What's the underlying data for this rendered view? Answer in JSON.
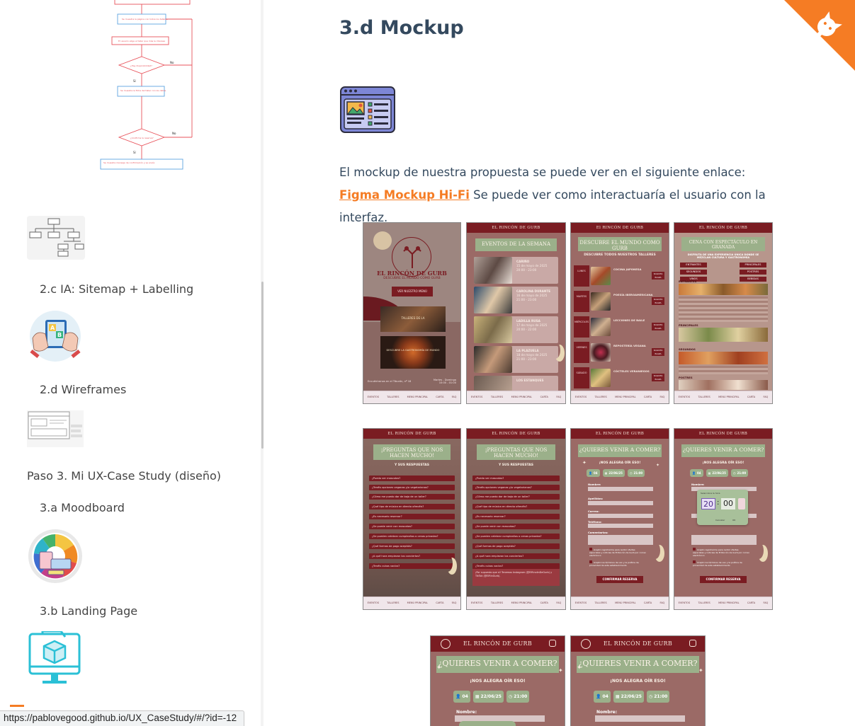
{
  "sidebar": {
    "items": [
      {
        "label": "2.c IA: Sitemap + Labelling"
      },
      {
        "label": "2.d Wireframes"
      },
      {
        "label": "Paso 3. Mi UX-Case Study (diseño)"
      },
      {
        "label": "3.a Moodboard"
      },
      {
        "label": "3.b Landing Page"
      }
    ],
    "flowchart": {
      "yes_label_1": "No",
      "yes_label_2": "No"
    }
  },
  "main": {
    "title": "3.d Mockup",
    "paragraph": {
      "before_link": "El mockup de nuestra propuesta se puede ver en el siguiente enlace: ",
      "link_text": "Figma Mockup Hi-Fi",
      "after_link": " Se puede ver como interactuaría el usuario con la interfaz."
    }
  },
  "mockups": {
    "brand": "EL RINCÓN DE GURB",
    "brand_title_case": "El RINCÓN DE GURB",
    "nav": [
      "EVENTOS",
      "TALLERES",
      "MENÚ PRINCIPAL",
      "CARTA",
      "FAQ"
    ],
    "home": {
      "tagline": "DESCUBRE EL MUNDO COMO GURB",
      "menu_button": "VER NUESTRO MENÚ",
      "card1": "TALLERES DE LA",
      "card2": "DESCUBRE LA GASTRONOMÍA DE MUNDO",
      "address": "Encuéntranos en el Tiburón, nº 18",
      "hours": "Martes - Domingo 10:00 - 01:00"
    },
    "events": {
      "heading": "EVENTOS DE LA SEMANA",
      "items": [
        {
          "name": "CARIÑO",
          "date": "15 de mayo de 2025",
          "time": "20:00 - 23:00"
        },
        {
          "name": "CAROLINA DURANTE",
          "date": "16 de mayo de 2025",
          "time": "21:00 - 23:00"
        },
        {
          "name": "LADILLA RUSA",
          "date": "17 de mayo de 2025",
          "time": "20:00 - 22:00"
        },
        {
          "name": "LA PLAZUELA",
          "date": "18 de mayo de 2025",
          "time": "21:00 - 23:00"
        },
        {
          "name": "LOS ESTANQUES",
          "date": "",
          "time": ""
        }
      ]
    },
    "talleres": {
      "heading": "DESCUBRE EL MUNDO COMO GURB",
      "sub": "DESCUBRE TODOS NUESTROS TALLERES",
      "items": [
        {
          "day": "LUNES",
          "name": "COCINA JAPONESA"
        },
        {
          "day": "MARTES",
          "name": "POESÍA IBEROAMERICANA"
        },
        {
          "day": "MIÉRCOLES",
          "name": "LECCIONES DE BAILE"
        },
        {
          "day": "VIERNES",
          "name": "REPOSTERÍA VEGANA"
        },
        {
          "day": "SÁBADO",
          "name": "CÓCTELES VERANIEGOS"
        }
      ],
      "button": "SOLICITA PLAZA"
    },
    "cena": {
      "heading": "CENA CON ESPECTÁCULO EN GRANADA",
      "sub": "DISFRUTA DE UNA EXPERIENCIA ÚNICA DONDE SE MEZCLAN CULTURA Y GASTRONOMÍA",
      "tabs": [
        "ENTRANTES",
        "PRINCIPALES",
        "SEGUNDOS",
        "POSTRES",
        "VINOS",
        "BEBIDAS"
      ],
      "section1": "ENTRANTES",
      "section2": "PRINCIPALES",
      "section3": "SEGUNDOS",
      "section4": "POSTRES"
    },
    "faq": {
      "heading": "¡PREGUNTAS QUE NOS HACEN MUCHO!",
      "sub": "Y SUS RESPUESTAS",
      "questions": [
        "¿Puedo ver mascotas?",
        "¿Tenéis opciones veganas y/o vegetarianas?",
        "¿Cómo me puedo dar de baja de un taller?",
        "¿Qué tipo de música en directo ofrecéis?",
        "¿Es necesario reservar?",
        "¿Se puede venir con mascotas?",
        "¿Se pueden celebrar cumpleaños o cenas privadas?",
        "¿Qué formas de pago aceptáis?",
        "¿A qué hora empiezan los conciertos?",
        "¿Tenéis cubos vacíos?"
      ],
      "answer": "¡Por supuesto que sí! Tenemos Instagram (@ElRincónDeGurb) y TikTok (@ElRinGurb)."
    },
    "reserva": {
      "heading": "¿QUIERES VENIR A COMER?",
      "sub": "¡NOS ALEGRA OÍR ESO!",
      "people": "04",
      "date": "22/06/25",
      "time": "21:00",
      "fields": [
        "Nombre:",
        "Apellidos:",
        "Correo:",
        "Teléfono:",
        "Comentarios:"
      ],
      "phone_prefix": "+34",
      "check1": "Acepto registrarme para recibir ofertas especiales y noticias de El Rincón de Gurb por correo electrónico",
      "check2": "Acepto los términos de uso y la política de privacidad de este establecimiento",
      "button": "CONFIRMAR RESERVA",
      "picker_hour": "20",
      "picker_min": "00",
      "picker_cancel": "Cancelar",
      "picker_ok": "OK",
      "picker_title": "Selecciona la hora"
    }
  },
  "statusbar": {
    "url": "https://pablovegood.github.io/UX_CaseStudy/#/?id=-12"
  },
  "colors": {
    "accent": "#f57c24",
    "heading": "#34495e",
    "burgundy": "#7a1c22",
    "sage": "#9bb08a",
    "mauve": "#9b6a66"
  },
  "icons": {
    "corner": "github-octocat-icon",
    "mockup": "web-layout-icon",
    "landing": "box-monitor-icon"
  }
}
